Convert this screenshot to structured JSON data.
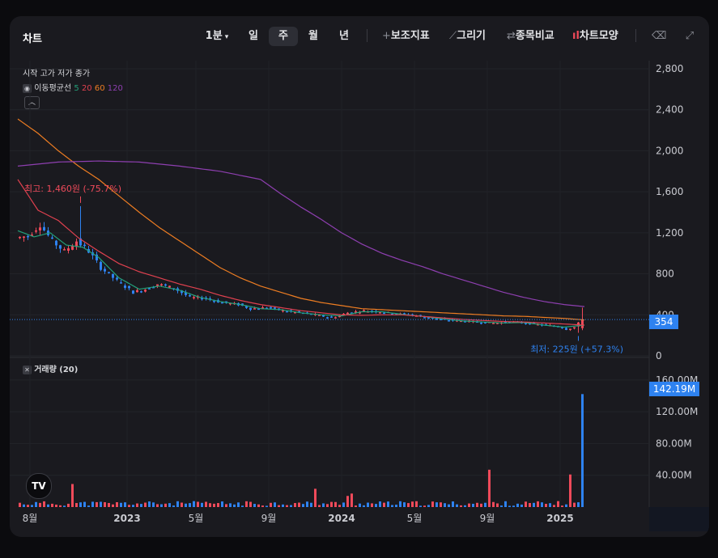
{
  "toolbar": {
    "title": "차트",
    "interval": "1분",
    "periods": [
      "일",
      "주",
      "월",
      "년"
    ],
    "selected_period": "주",
    "tools": [
      "보조지표",
      "그리기",
      "종목비교",
      "차트모양"
    ]
  },
  "legend": {
    "ohlc_label": "시작 고가 저가 종가",
    "ma_label": "이동평균선",
    "ma_periods": [
      "5",
      "20",
      "60",
      "120"
    ],
    "volume_label": "거래량 (20)"
  },
  "colors": {
    "up": "#ef4a5a",
    "down": "#2e82f0",
    "ma5": "#23a07a",
    "ma20": "#e0414f",
    "ma60": "#ee7d22",
    "ma120": "#8e3fb0",
    "accent": "#2e82f0"
  },
  "annotations": {
    "high_label": "최고: 1,460원 (-75.7%)",
    "low_label": "최저: 225원 (+57.3%)"
  },
  "price_badge": "354",
  "volume_badge": "142.19M",
  "chart_data": [
    {
      "type": "candlestick",
      "title": "",
      "ylim": [
        0,
        2800
      ],
      "yticks": [
        "2,800",
        "2,400",
        "2,000",
        "1,600",
        "1,200",
        "800",
        "400",
        "0"
      ],
      "current_price": 354,
      "high": 1460,
      "low": 225,
      "anchors": [
        [
          0,
          1150
        ],
        [
          3,
          1170
        ],
        [
          6,
          1280
        ],
        [
          9,
          1120
        ],
        [
          12,
          1020
        ],
        [
          15,
          1120
        ],
        [
          18,
          1020
        ],
        [
          21,
          860
        ],
        [
          25,
          730
        ],
        [
          29,
          620
        ],
        [
          32,
          650
        ],
        [
          35,
          700
        ],
        [
          39,
          660
        ],
        [
          43,
          570
        ],
        [
          47,
          560
        ],
        [
          51,
          520
        ],
        [
          55,
          500
        ],
        [
          58,
          460
        ],
        [
          62,
          470
        ],
        [
          66,
          440
        ],
        [
          70,
          420
        ],
        [
          74,
          400
        ],
        [
          78,
          370
        ],
        [
          82,
          420
        ],
        [
          86,
          440
        ],
        [
          90,
          430
        ],
        [
          94,
          410
        ],
        [
          98,
          400
        ],
        [
          102,
          370
        ],
        [
          106,
          350
        ],
        [
          110,
          340
        ],
        [
          114,
          330
        ],
        [
          118,
          320
        ],
        [
          122,
          330
        ],
        [
          126,
          320
        ],
        [
          130,
          300
        ],
        [
          134,
          290
        ],
        [
          136,
          260
        ],
        [
          138,
          280
        ],
        [
          140,
          354
        ]
      ],
      "ma_anchors": {
        "5": [
          [
            0,
            1220
          ],
          [
            4,
            1160
          ],
          [
            8,
            1200
          ],
          [
            12,
            1080
          ],
          [
            16,
            1060
          ],
          [
            20,
            960
          ],
          [
            25,
            760
          ],
          [
            30,
            650
          ],
          [
            35,
            680
          ],
          [
            40,
            640
          ],
          [
            45,
            570
          ],
          [
            50,
            530
          ],
          [
            55,
            500
          ],
          [
            60,
            460
          ],
          [
            65,
            450
          ],
          [
            70,
            420
          ],
          [
            75,
            400
          ],
          [
            80,
            390
          ],
          [
            85,
            430
          ],
          [
            90,
            430
          ],
          [
            95,
            405
          ],
          [
            100,
            385
          ],
          [
            105,
            360
          ],
          [
            110,
            340
          ],
          [
            115,
            330
          ],
          [
            120,
            320
          ],
          [
            125,
            325
          ],
          [
            130,
            300
          ],
          [
            135,
            280
          ],
          [
            140,
            300
          ]
        ],
        "20": [
          [
            0,
            1720
          ],
          [
            5,
            1420
          ],
          [
            10,
            1320
          ],
          [
            15,
            1150
          ],
          [
            20,
            1020
          ],
          [
            25,
            900
          ],
          [
            30,
            820
          ],
          [
            35,
            760
          ],
          [
            40,
            700
          ],
          [
            45,
            650
          ],
          [
            50,
            590
          ],
          [
            55,
            540
          ],
          [
            60,
            500
          ],
          [
            65,
            470
          ],
          [
            70,
            440
          ],
          [
            75,
            420
          ],
          [
            80,
            400
          ],
          [
            85,
            395
          ],
          [
            90,
            400
          ],
          [
            95,
            400
          ],
          [
            100,
            385
          ],
          [
            105,
            370
          ],
          [
            110,
            355
          ],
          [
            115,
            345
          ],
          [
            120,
            335
          ],
          [
            125,
            330
          ],
          [
            130,
            320
          ],
          [
            135,
            310
          ],
          [
            140,
            300
          ]
        ],
        "60": [
          [
            0,
            2310
          ],
          [
            5,
            2170
          ],
          [
            10,
            2000
          ],
          [
            15,
            1850
          ],
          [
            20,
            1720
          ],
          [
            25,
            1560
          ],
          [
            30,
            1400
          ],
          [
            35,
            1250
          ],
          [
            40,
            1120
          ],
          [
            45,
            990
          ],
          [
            50,
            860
          ],
          [
            55,
            760
          ],
          [
            60,
            680
          ],
          [
            65,
            620
          ],
          [
            70,
            560
          ],
          [
            75,
            520
          ],
          [
            80,
            490
          ],
          [
            85,
            460
          ],
          [
            90,
            450
          ],
          [
            95,
            440
          ],
          [
            100,
            430
          ],
          [
            105,
            420
          ],
          [
            110,
            410
          ],
          [
            115,
            400
          ],
          [
            120,
            390
          ],
          [
            125,
            385
          ],
          [
            130,
            375
          ],
          [
            135,
            365
          ],
          [
            140,
            350
          ]
        ],
        "120": [
          [
            0,
            1850
          ],
          [
            10,
            1890
          ],
          [
            20,
            1900
          ],
          [
            30,
            1890
          ],
          [
            40,
            1850
          ],
          [
            50,
            1800
          ],
          [
            60,
            1720
          ],
          [
            65,
            1580
          ],
          [
            70,
            1450
          ],
          [
            75,
            1330
          ],
          [
            80,
            1200
          ],
          [
            85,
            1090
          ],
          [
            90,
            1000
          ],
          [
            95,
            930
          ],
          [
            100,
            870
          ],
          [
            105,
            800
          ],
          [
            110,
            740
          ],
          [
            115,
            680
          ],
          [
            120,
            620
          ],
          [
            125,
            570
          ],
          [
            130,
            530
          ],
          [
            135,
            500
          ],
          [
            140,
            480
          ]
        ]
      }
    },
    {
      "type": "bar",
      "title": "거래량",
      "ylim": [
        0,
        170
      ],
      "yticks": [
        "160.00M",
        "120.00M",
        "80.00M",
        "40.00M"
      ],
      "unit": "M",
      "spikes": [
        [
          13,
          29
        ],
        [
          73,
          23
        ],
        [
          81,
          14
        ],
        [
          82,
          17
        ],
        [
          116,
          47
        ],
        [
          136,
          41
        ],
        [
          139,
          142.19
        ]
      ],
      "baseline": 5
    }
  ],
  "x_axis": {
    "ticks": [
      {
        "label": "8월",
        "i": 3
      },
      {
        "label": "2023",
        "i": 27
      },
      {
        "label": "5월",
        "i": 44
      },
      {
        "label": "9월",
        "i": 62
      },
      {
        "label": "2024",
        "i": 80
      },
      {
        "label": "5월",
        "i": 98
      },
      {
        "label": "9월",
        "i": 116
      },
      {
        "label": "2025",
        "i": 134
      }
    ]
  }
}
